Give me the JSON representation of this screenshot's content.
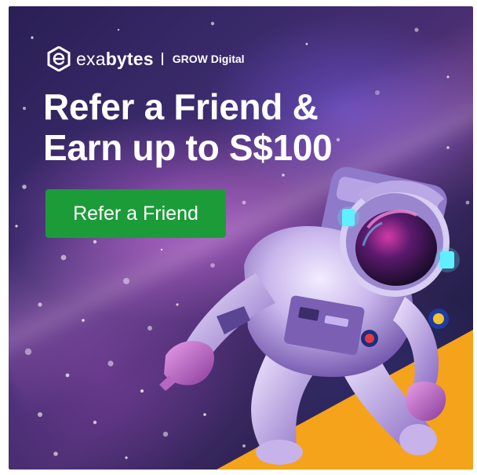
{
  "ad": {
    "brand": {
      "name_light": "exa",
      "name_bold": "bytes",
      "partner": "GROW Digital"
    },
    "headline": {
      "line1": "Refer a Friend &",
      "line2": "Earn up to S$100"
    },
    "cta_label": "Refer a Friend",
    "colors": {
      "cta": "#1c9c39",
      "accent_corner": "#f5a31a",
      "text": "#ffffff"
    },
    "icons": [
      "exabytes-logo-icon",
      "astronaut-illustration"
    ]
  }
}
